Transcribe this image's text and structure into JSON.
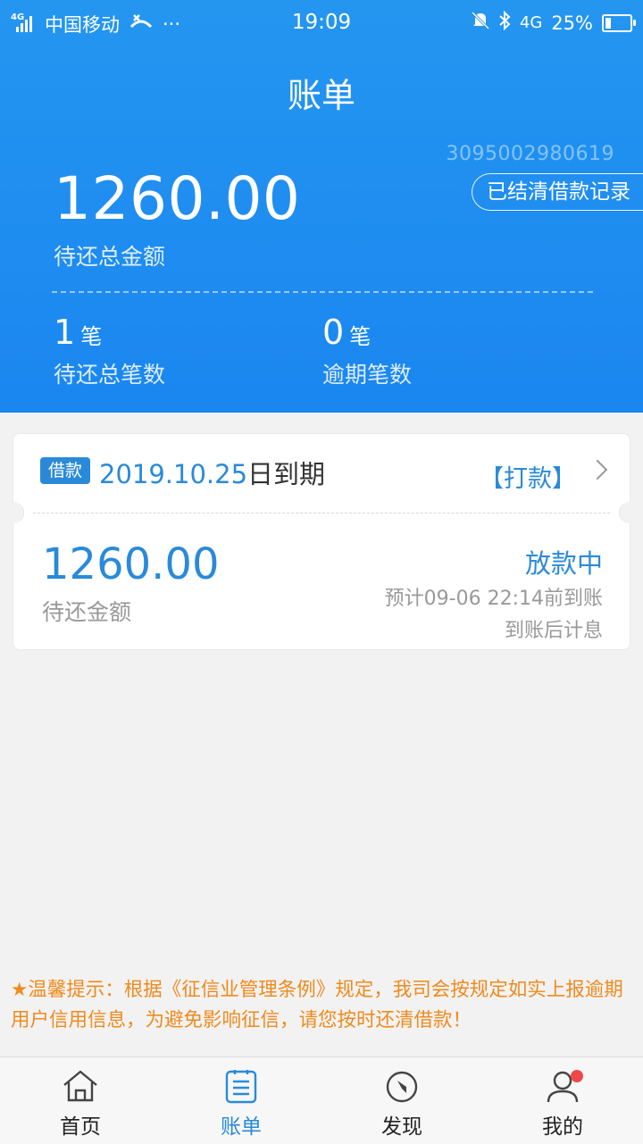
{
  "status_bar": {
    "network_tag": "4G",
    "carrier": "中国移动",
    "more": "···",
    "time": "19:09",
    "net": "4G",
    "battery": "25%",
    "battery_level": 0.25
  },
  "header": {
    "title": "账单",
    "account_no": "3095002980619",
    "history_button": "已结清借款记录"
  },
  "summary": {
    "amount": "1260.00",
    "amount_label": "待还总金额",
    "stats": [
      {
        "value": "1",
        "unit": "笔",
        "label": "待还总笔数"
      },
      {
        "value": "0",
        "unit": "笔",
        "label": "逾期笔数"
      }
    ]
  },
  "bill_card": {
    "tag": "借款",
    "due_date": "2019.10.25",
    "due_suffix": "日到期",
    "action": "【打款】",
    "amount": "1260.00",
    "amount_label": "待还金额",
    "status": "放款中",
    "eta": "预计09-06 22:14前到账",
    "note": "到账后计息"
  },
  "tip": "★温馨提示：根据《征信业管理条例》规定，我司会按规定如实上报逾期用户信用信息，为避免影响征信，请您按时还清借款！",
  "tabs": [
    {
      "label": "首页",
      "icon": "home-icon"
    },
    {
      "label": "账单",
      "icon": "bill-icon"
    },
    {
      "label": "发现",
      "icon": "compass-icon"
    },
    {
      "label": "我的",
      "icon": "user-icon"
    }
  ],
  "colors": {
    "brand_blue": "#1a86f0",
    "accent_blue": "#2a8ad9",
    "tip_orange": "#f08a1c",
    "badge_red": "#f04848"
  }
}
